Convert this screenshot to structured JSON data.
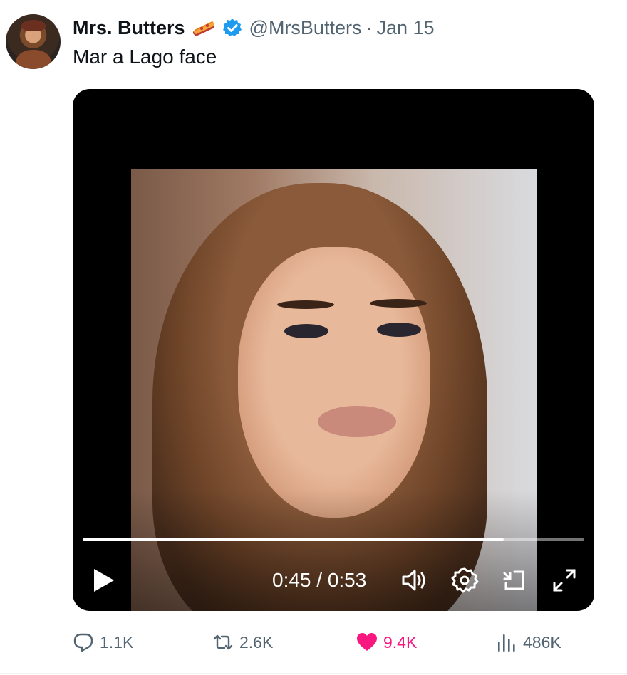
{
  "tweet": {
    "author_name": "Mrs. Butters",
    "handle": "@MrsButters",
    "separator": "·",
    "date": "Jan 15",
    "text": "Mar a Lago face",
    "verified_icon": "verified-badge-icon",
    "emoji_icon": "pie-icon"
  },
  "video": {
    "time_display": "0:45 / 0:53",
    "progress": 0.84,
    "controls": [
      "play-icon",
      "volume-icon",
      "gear-icon",
      "minimize-icon",
      "fullscreen-icon"
    ]
  },
  "actions": {
    "replies": "1.1K",
    "retweets": "2.6K",
    "likes": "9.4K",
    "views": "486K"
  },
  "colors": {
    "text_primary": "#0f1419",
    "text_secondary": "#536471",
    "verified": "#1d9bf0",
    "like": "#f91880"
  }
}
